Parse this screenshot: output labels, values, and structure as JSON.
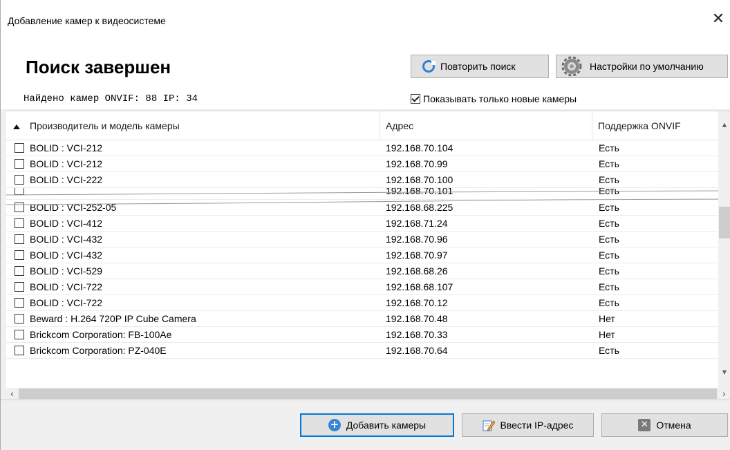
{
  "window": {
    "title": "Добавление камер к видеосистеме",
    "close_glyph": "✕"
  },
  "header": {
    "status_title": "Поиск завершен",
    "found_summary": "Найдено камер ONVIF: 88 IP: 34",
    "repeat_search_label": "Повторить поиск",
    "defaults_label": "Настройки по умолчанию",
    "show_new_only_label": "Показывать только новые камеры",
    "show_new_only_checked": true
  },
  "table": {
    "columns": {
      "model": "Производитель и модель камеры",
      "address": "Адрес",
      "onvif": "Поддержка ONVIF"
    },
    "sort_indicator": "ascending",
    "rows": [
      {
        "model": "BOLID : VCI-212",
        "address": "192.168.70.104",
        "onvif": "Есть",
        "checked": false
      },
      {
        "model": "BOLID : VCI-212",
        "address": "192.168.70.99",
        "onvif": "Есть",
        "checked": false
      },
      {
        "model": "BOLID : VCI-222",
        "address": "192.168.70.100",
        "onvif": "Есть",
        "checked": false
      },
      {
        "model": "",
        "address": "192.168.70.101",
        "onvif": "Есть",
        "checked": false
      },
      {
        "model": "BOLID : VCI-252-05",
        "address": "192.168.68.225",
        "onvif": "Есть",
        "checked": false
      },
      {
        "model": "BOLID : VCI-412",
        "address": "192.168.71.24",
        "onvif": "Есть",
        "checked": false
      },
      {
        "model": "BOLID : VCI-432",
        "address": "192.168.70.96",
        "onvif": "Есть",
        "checked": false
      },
      {
        "model": "BOLID : VCI-432",
        "address": "192.168.70.97",
        "onvif": "Есть",
        "checked": false
      },
      {
        "model": "BOLID : VCI-529",
        "address": "192.168.68.26",
        "onvif": "Есть",
        "checked": false
      },
      {
        "model": "BOLID : VCI-722",
        "address": "192.168.68.107",
        "onvif": "Есть",
        "checked": false
      },
      {
        "model": "BOLID : VCI-722",
        "address": "192.168.70.12",
        "onvif": "Есть",
        "checked": false
      },
      {
        "model": "Beward : H.264 720P IP Cube Camera",
        "address": "192.168.70.48",
        "onvif": "Нет",
        "checked": false
      },
      {
        "model": "Brickcom Corporation: FB-100Ae",
        "address": "192.168.70.33",
        "onvif": "Нет",
        "checked": false
      },
      {
        "model": "Brickcom Corporation: PZ-040E",
        "address": "192.168.70.64",
        "onvif": "Есть",
        "checked": false
      }
    ]
  },
  "footer": {
    "add_label": "Добавить камеры",
    "enter_ip_label": "Ввести IP-адрес",
    "cancel_label": "Отмена"
  },
  "icons": {
    "refresh": "refresh-icon",
    "gear": "gear-icon",
    "plus": "plus-circle-icon",
    "edit": "pencil-icon",
    "cancel": "cancel-icon"
  },
  "colors": {
    "accent": "#0078d7",
    "button_bg": "#e1e1e1",
    "window_bg": "#f0f0f0"
  }
}
